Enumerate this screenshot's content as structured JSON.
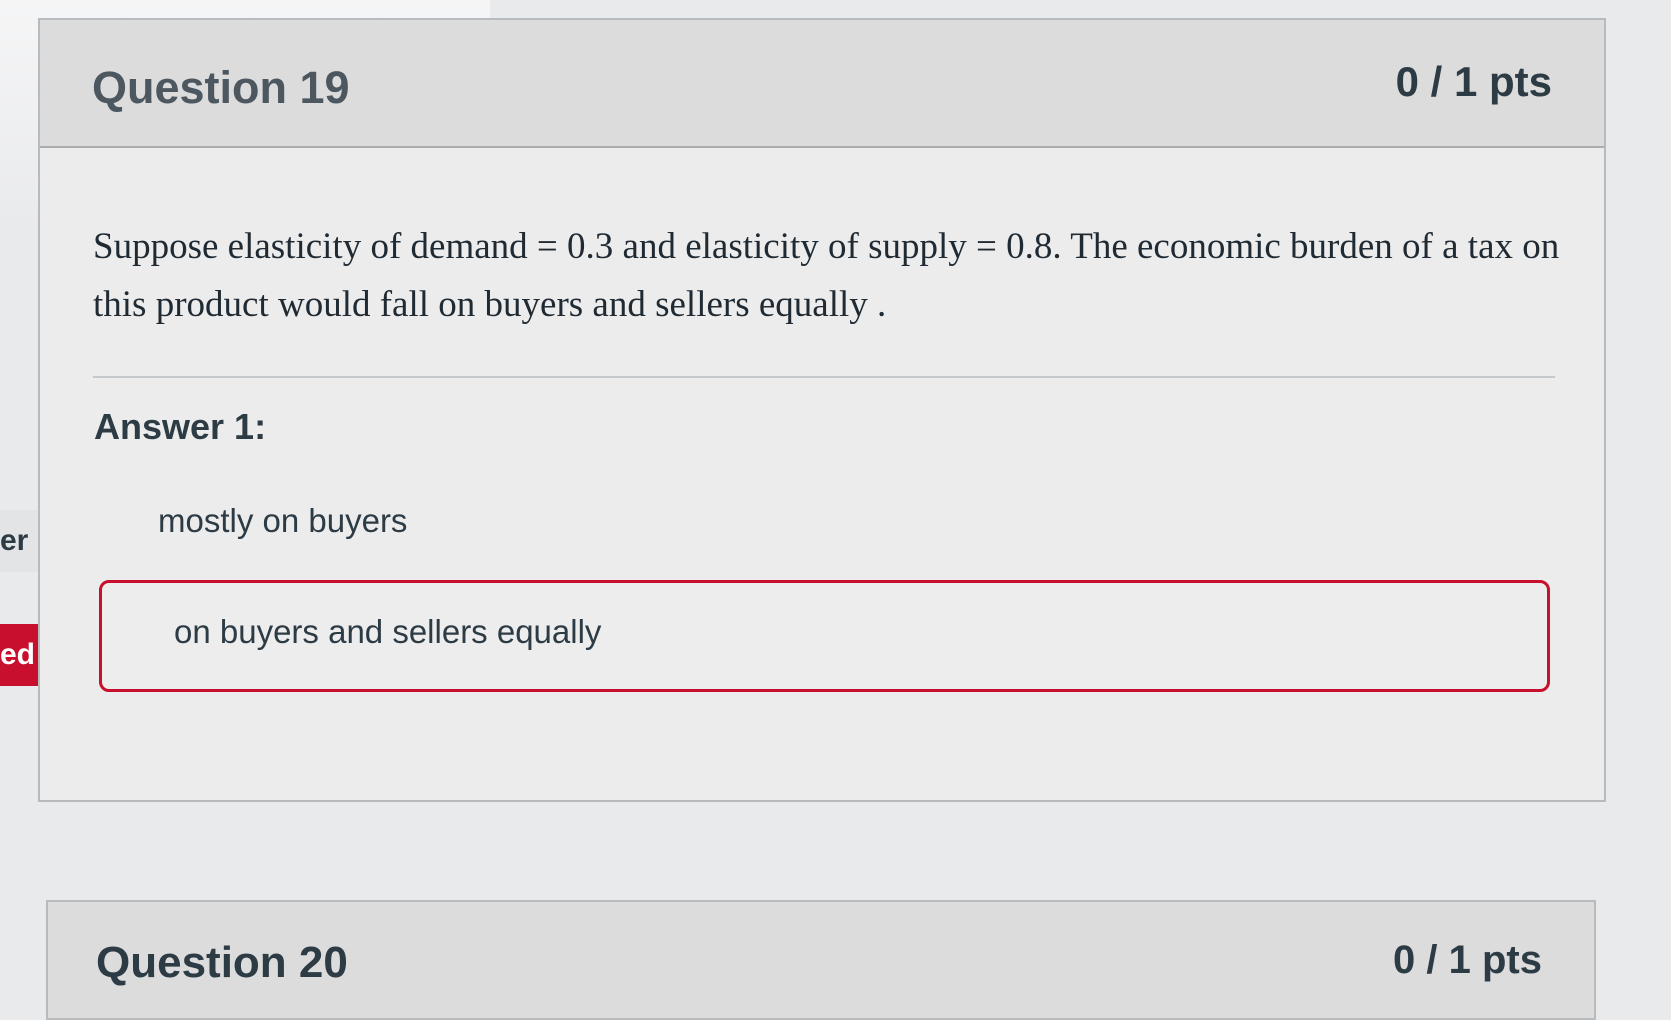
{
  "question": {
    "title": "Question 19",
    "points": "0 / 1 pts",
    "text": "Suppose elasticity of demand = 0.3 and elasticity of supply = 0.8. The economic burden of a tax on this product would fall on buyers and sellers equally .",
    "answer_label": "Answer 1:",
    "correct_answer": "mostly on buyers",
    "selected_answer": "on buyers and sellers equally"
  },
  "tags": {
    "correct_tag": "er",
    "selected_tag": "ed"
  },
  "next_question": {
    "title": "Question 20",
    "points": "0 / 1 pts"
  },
  "colors": {
    "incorrect_accent": "#c8102e",
    "text": "#2d3b45"
  }
}
